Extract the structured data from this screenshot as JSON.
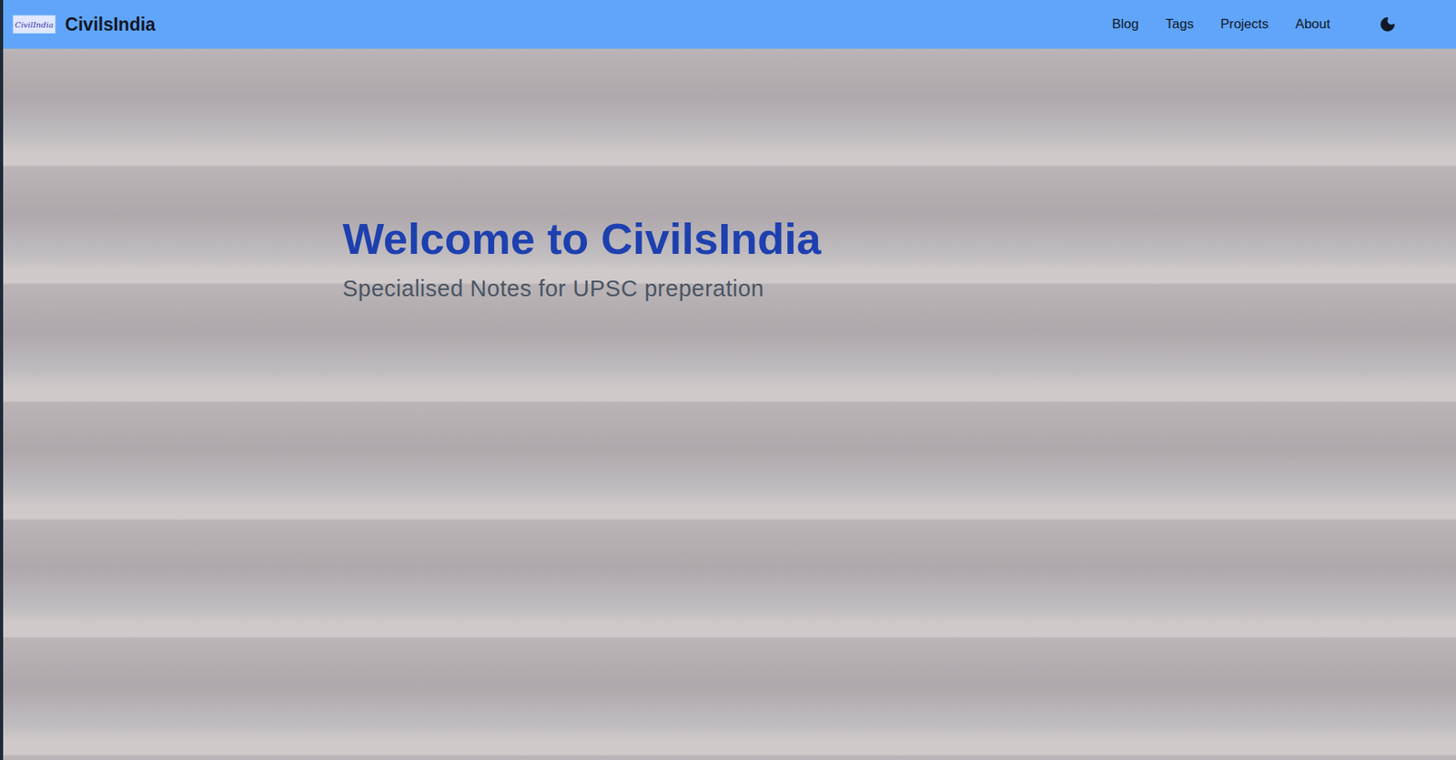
{
  "header": {
    "logo_text": "CivilIndia",
    "title": "CivilsIndia",
    "nav": [
      {
        "label": "Blog"
      },
      {
        "label": "Tags"
      },
      {
        "label": "Projects"
      },
      {
        "label": "About"
      }
    ],
    "theme_toggle": {
      "dark_mode": false
    }
  },
  "hero": {
    "title": "Welcome to CivilsIndia",
    "subtitle": "Specialised Notes for UPSC preperation"
  }
}
